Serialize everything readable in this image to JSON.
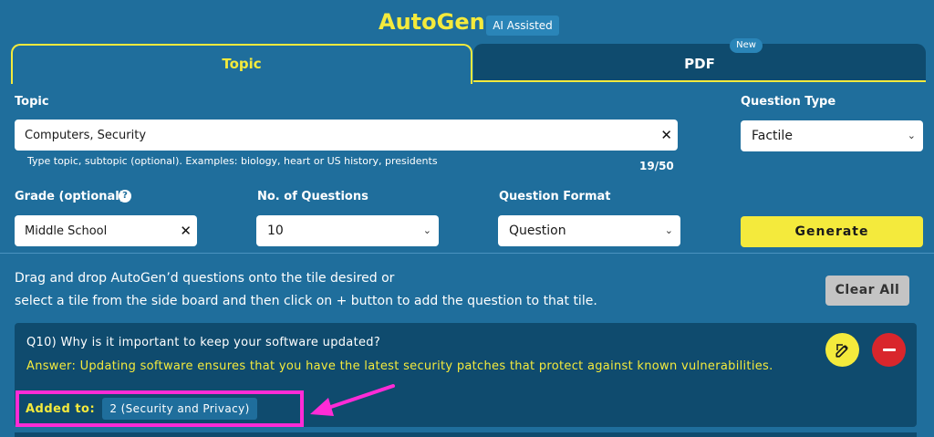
{
  "header": {
    "title": "AutoGen",
    "badge": "AI Assisted"
  },
  "tabs": [
    {
      "label": "Topic",
      "active": true
    },
    {
      "label": "PDF",
      "active": false,
      "badge": "New"
    }
  ],
  "form": {
    "topic": {
      "label": "Topic",
      "value": "Computers, Security",
      "hint": "Type topic, subtopic (optional). Examples: biology, heart or US history, presidents",
      "counter": "19/50"
    },
    "question_type": {
      "label": "Question Type",
      "value": "Factile"
    },
    "grade": {
      "label": "Grade (optional)",
      "value": "Middle School"
    },
    "num_questions": {
      "label": "No. of Questions",
      "value": "10"
    },
    "question_format": {
      "label": "Question Format",
      "value": "Question"
    },
    "generate_label": "Generate"
  },
  "instructions": {
    "line1": "Drag and drop AutoGen’d questions onto the tile desired or",
    "line2": "select a tile from the side board and then click on + button to add the question to that tile.",
    "clear_all_label": "Clear All"
  },
  "question_card": {
    "question": "Q10) Why is it important to keep your software updated?",
    "answer": "Answer: Updating software ensures that you have the latest security patches that protect against known vulnerabilities.",
    "added_to_label": "Added to:",
    "added_to_tile": "2 (Security and Privacy)"
  },
  "colors": {
    "background": "#1f6e9c",
    "accent_yellow": "#f4ea3c",
    "card": "#0f4b6e",
    "remove_red": "#d9262c",
    "annotation_magenta": "#ff2bd6"
  },
  "icons": [
    "clear-x-icon",
    "chevron-down-icon",
    "help-icon",
    "edit-pencil-icon",
    "minus-icon",
    "annotation-arrow-icon"
  ]
}
